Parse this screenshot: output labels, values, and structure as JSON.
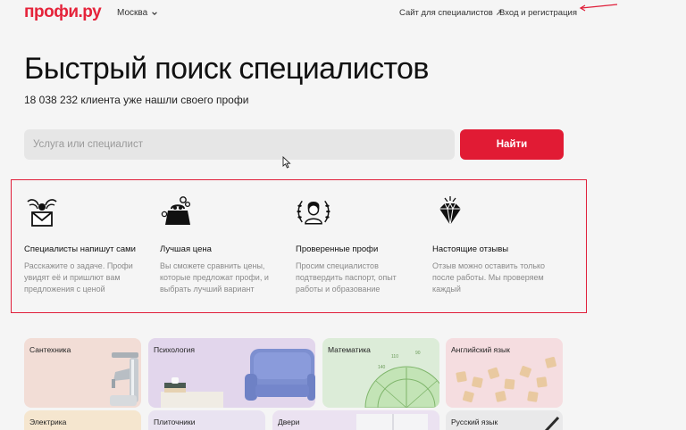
{
  "header": {
    "logo": "профи.ру",
    "city": "Москва",
    "nav_specialists": "Сайт для специалистов ↗",
    "nav_login": "Вход и регистрация"
  },
  "hero": {
    "title": "Быстрый поиск специалистов",
    "subtitle": "18 038 232 клиента уже нашли своего профи"
  },
  "search": {
    "placeholder": "Услуга или специалист",
    "button": "Найти"
  },
  "features": [
    {
      "title": "Специалисты напишут сами",
      "desc": "Расскажите о задаче. Профи увидят её и пришлют вам предложения с ценой",
      "icon": "envelope-wings-icon"
    },
    {
      "title": "Лучшая цена",
      "desc": "Вы сможете сравнить цены, которые предложат профи, и выбрать лучший вариант",
      "icon": "wallet-coins-icon"
    },
    {
      "title": "Проверенные профи",
      "desc": "Просим специалистов подтвердить паспорт, опыт работы и образование",
      "icon": "laurel-person-icon"
    },
    {
      "title": "Настоящие отзывы",
      "desc": "Отзыв можно оставить только после работы. Мы проверяем каждый",
      "icon": "diamond-icon"
    }
  ],
  "categories": [
    {
      "label": "Сантехника",
      "color": "#f2ddd6"
    },
    {
      "label": "Психология",
      "color": "#e2d6ec"
    },
    {
      "label": "Математика",
      "color": "#dcecd8"
    },
    {
      "label": "Английский язык",
      "color": "#f5dde0"
    },
    {
      "label": "Электрика",
      "color": "#f5e6cf"
    },
    {
      "label": "Плиточники",
      "color": "#e9e3f1"
    },
    {
      "label": "Двери",
      "color": "#ebe2f1"
    },
    {
      "label": "Русский язык",
      "color": "#e9e9ea"
    }
  ],
  "colors": {
    "accent": "#e11b34",
    "annotation": "#e01f3a"
  }
}
